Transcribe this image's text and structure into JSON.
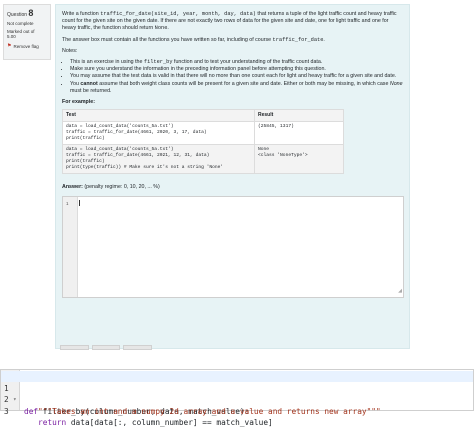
{
  "question": {
    "label": "Question",
    "number": "8",
    "status": "Not complete",
    "marks_line1": "Marked out of",
    "marks_line2": "5.00",
    "flag_label": "Remove flag"
  },
  "prompt": {
    "p1_a": "Write a function ",
    "p1_code": "traffic_for_date(site_id, year, month, day, data)",
    "p1_b": " that returns a tuple of the light traffic count and heavy traffic count for the given site on the given date. If there are not exactly two rows of data for the given site and date, one for light traffic and one for heavy traffic, the function should return ",
    "p1_none": "None",
    "p1_end": ".",
    "p2_a": "The answer box must contain all the functions you have written so far, including of course ",
    "p2_code": "traffic_for_date",
    "p2_end": ".",
    "notes_label": "Notes:",
    "n1_a": "This is an exercise in using the ",
    "n1_code": "filter_by",
    "n1_b": " function and to test your understanding of the traffic count data.",
    "n2": "Make sure you understand the information in the preceding information panel before attempting this question.",
    "n3": "You may assume that the test data is valid in that there will no more than one count each for light and heavy traffic for a given site and date.",
    "n4_a": "You ",
    "n4_bold": "cannot",
    "n4_b": " assume that both weight class counts will be present for a given site and date. Either or both may be missing, in which case ",
    "n4_none": "None",
    "n4_c": " must be returned.",
    "for_example": "For example:"
  },
  "examples": {
    "header_test": "Test",
    "header_result": "Result",
    "rows": [
      {
        "test": "data = load_count_data('counts_5a.txt')\ntraffic = traffic_for_date(4661, 2020, 3, 17, data)\nprint(traffic)",
        "result": "(25845, 1317)"
      },
      {
        "test": "data = load_count_data('counts_5a.txt')\ntraffic = traffic_for_date(4661, 2021, 12, 31, data)\nprint(traffic)\nprint(type(traffic)) # Make sure it's not a string 'None'",
        "result": "None\n<class 'NoneType'>"
      }
    ]
  },
  "answer": {
    "label": "Answer:",
    "penalty": "(penalty regime: 0, 10, 20, ... %)",
    "line_number": "1"
  },
  "snippet": {
    "lines": [
      {
        "num": "1",
        "fold": "▾",
        "kw": "def ",
        "rest": "filter_by(column_number, data, match_value):"
      },
      {
        "num": "2",
        "fold": "",
        "kw": "",
        "rest": "\"\"\"Takes an int and a numpy 2d array and a value and returns new array\"\"\""
      },
      {
        "num": "3",
        "fold": "",
        "kw": "return ",
        "rest": "data[data[:, column_number] == match_value]"
      }
    ]
  }
}
